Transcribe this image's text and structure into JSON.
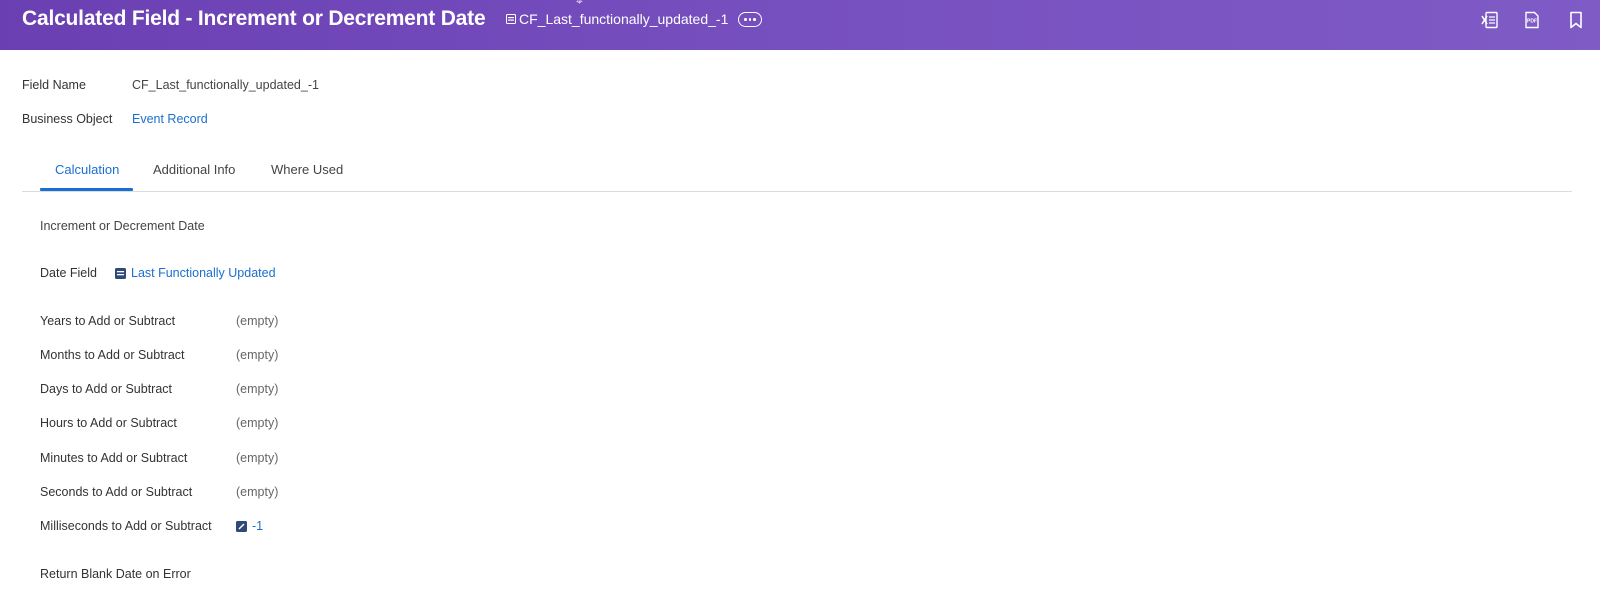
{
  "header": {
    "title": "Calculated Field - Increment or Decrement Date",
    "instance_name": "CF_Last_functionally_updated_-1",
    "icons": [
      "more-icon",
      "excel-export-icon",
      "pdf-export-icon",
      "bookmark-icon"
    ]
  },
  "fields": {
    "field_name_label": "Field Name",
    "field_name_value": "CF_Last_functionally_updated_-1",
    "business_object_label": "Business Object",
    "business_object_value": "Event Record"
  },
  "tabs": [
    {
      "label": "Calculation",
      "active": true
    },
    {
      "label": "Additional Info",
      "active": false
    },
    {
      "label": "Where Used",
      "active": false
    }
  ],
  "calculation": {
    "section_title": "Increment or Decrement Date",
    "date_field_label": "Date Field",
    "date_field_value": "Last Functionally Updated",
    "rows": [
      {
        "label": "Years to Add or Subtract",
        "value": "(empty)"
      },
      {
        "label": "Months to Add or Subtract",
        "value": "(empty)"
      },
      {
        "label": "Days to Add or Subtract",
        "value": "(empty)"
      },
      {
        "label": "Hours to Add or Subtract",
        "value": "(empty)"
      },
      {
        "label": "Minutes to Add or Subtract",
        "value": "(empty)"
      },
      {
        "label": "Seconds to Add or Subtract",
        "value": "(empty)"
      }
    ],
    "milliseconds_label": "Milliseconds to Add or Subtract",
    "milliseconds_value": "-1",
    "return_blank_label": "Return Blank Date on Error"
  },
  "colors": {
    "header_start": "#6a3fb2",
    "header_end": "#7f5bc6",
    "link": "#1b6fd0",
    "icon_fill": "#2f4a78"
  }
}
